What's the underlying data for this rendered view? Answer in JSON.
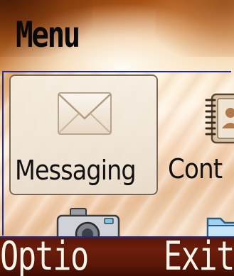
{
  "screen": {
    "title": "Menu"
  },
  "grid": {
    "items": [
      {
        "label": "Messaging",
        "icon": "envelope-icon",
        "selected": true
      },
      {
        "label": "Cont",
        "icon": "contacts-icon",
        "selected": false
      },
      {
        "label": "",
        "icon": "camera-icon",
        "selected": false
      },
      {
        "label": "",
        "icon": "folder-icon",
        "selected": false
      }
    ]
  },
  "softkeys": {
    "left": "Optio",
    "right": "Exit"
  },
  "colors": {
    "frame_blue": "#1e2a9a",
    "softkey_bar": "#5a1608",
    "softkey_text": "#fff4e8",
    "selection_border": "#7a6552"
  }
}
